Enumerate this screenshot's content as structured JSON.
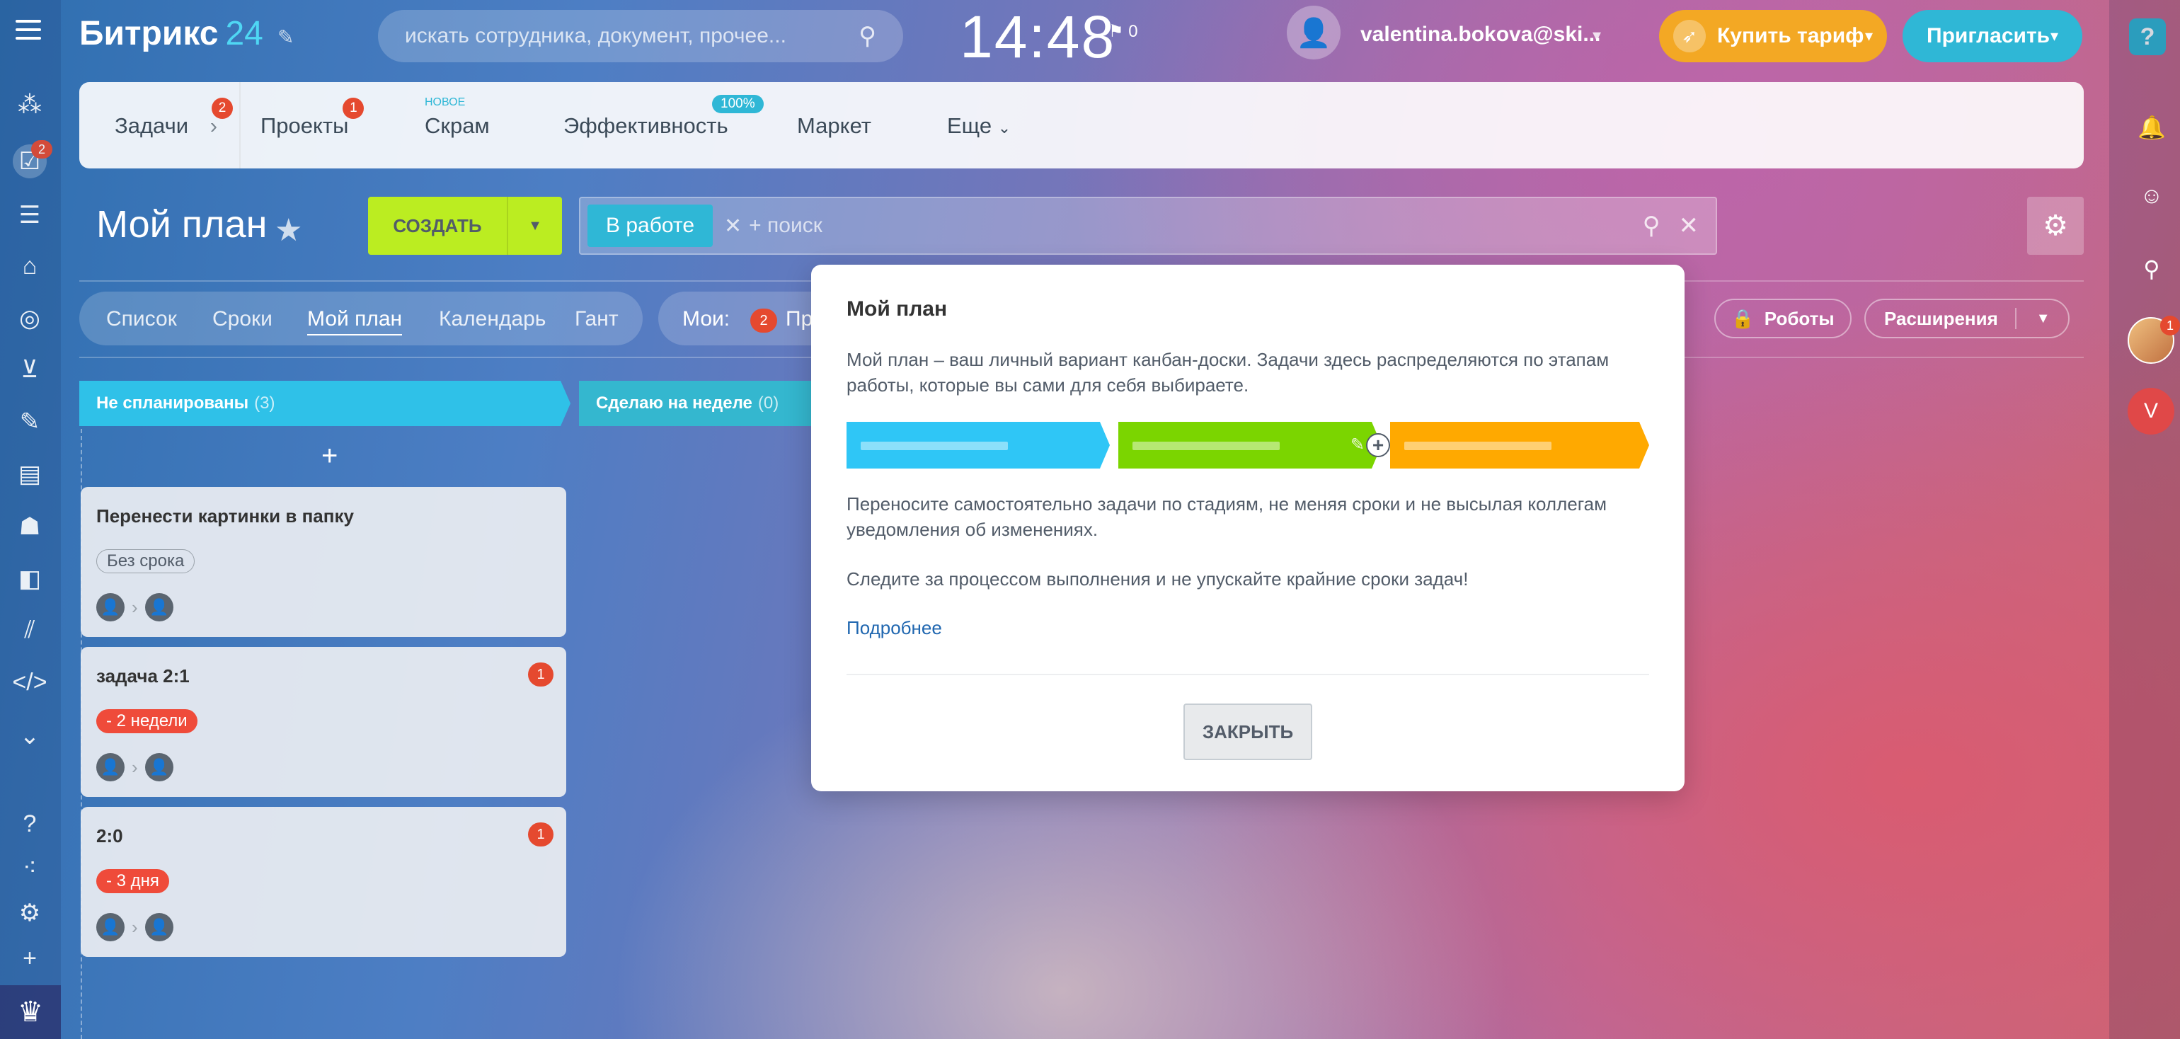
{
  "header": {
    "logo_text": "Битрикс",
    "logo_num": "24",
    "search_placeholder": "искать сотрудника, документ, прочее...",
    "clock": "14:48",
    "flag_count": "0",
    "user_email": "valentina.bokova@ski...",
    "buy_label": "Купить тариф",
    "invite_label": "Пригласить",
    "help_label": "?"
  },
  "left_rail": {
    "tasks_badge": "2"
  },
  "nav": {
    "items": [
      {
        "label": "Задачи",
        "badge": "2"
      },
      {
        "label": "Проекты",
        "badge": "1"
      },
      {
        "label": "Скрам",
        "tag": "НОВОЕ"
      },
      {
        "label": "Эффективность",
        "tag": "100%"
      },
      {
        "label": "Маркет"
      },
      {
        "label": "Еще"
      }
    ]
  },
  "toolbar": {
    "title": "Мой план",
    "create_label": "СОЗДАТЬ",
    "filter_chip": "В работе",
    "filter_placeholder": "+ поиск"
  },
  "views": {
    "tabs": [
      "Список",
      "Сроки",
      "Мой план",
      "Календарь",
      "Гант"
    ],
    "active": "Мой план",
    "moi_label": "Мои:",
    "moi_badge": "2",
    "moi_rest": "Пр",
    "robots_label": "Роботы",
    "extensions_label": "Расширения"
  },
  "columns": [
    {
      "title": "Не спланированы",
      "count": "(3)"
    },
    {
      "title": "Сделаю на неделе",
      "count": "(0)"
    }
  ],
  "cards": [
    {
      "title": "Перенести картинки в папку",
      "deadline": "Без срока",
      "count": ""
    },
    {
      "title": "задача 2:1",
      "deadline": "- 2 недели",
      "count": "1"
    },
    {
      "title": "2:0",
      "deadline": "- 3 дня",
      "count": "1"
    }
  ],
  "modal": {
    "title": "Мой план",
    "text1": "Мой план – ваш личный вариант канбан-доски. Задачи здесь распределяются по этапам работы, которые вы сами для себя выбираете.",
    "text2": "Переносите самостоятельно задачи по стадиям, не меняя сроки и не высылая коллегам уведомления об изменениях.",
    "text3": "Следите за процессом выполнения и не упускайте крайние сроки задач!",
    "link": "Подробнее",
    "close_label": "ЗАКРЫТЬ",
    "stage_colors": [
      "#2fc6f6",
      "#7bd500",
      "#ffa900"
    ]
  },
  "right_rail": {
    "avatar_badge": "1",
    "user_initial": "V"
  }
}
